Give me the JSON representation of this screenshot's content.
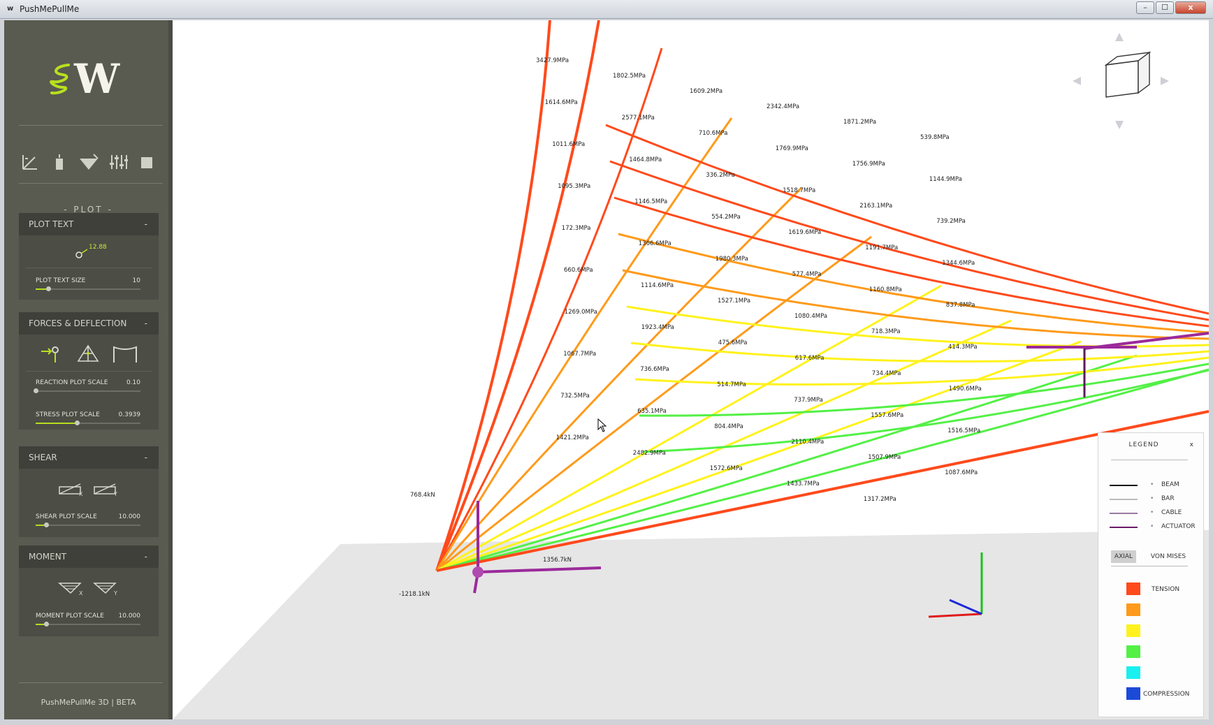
{
  "window": {
    "app_icon": "w",
    "title": "PushMePullMe",
    "minimize": "–",
    "maximize": "☐",
    "close": "x"
  },
  "sidebar": {
    "logo_text": "W",
    "tools": [
      "frame-icon",
      "load-icon",
      "support-icon",
      "sliders-icon",
      "export-icon"
    ],
    "section_label": "- PLOT -",
    "panels": {
      "plot_text": {
        "title": "PLOT TEXT",
        "collapse": "-",
        "knob_value": "12.88",
        "slider_label": "PLOT TEXT SIZE",
        "slider_value": "10",
        "slider_fraction": 0.12
      },
      "forces": {
        "title": "FORCES & DEFLECTION",
        "collapse": "-",
        "icons": [
          "reaction-icon",
          "truss-icon",
          "deflection-icon"
        ],
        "reaction_label": "REACTION PLOT SCALE",
        "reaction_value": "0.10",
        "reaction_fraction": 0.0,
        "stress_label": "STRESS PLOT SCALE",
        "stress_value": "0.3939",
        "stress_fraction": 0.39
      },
      "shear": {
        "title": "SHEAR",
        "collapse": "-",
        "icons": [
          "shear-x-icon",
          "shear-y-icon"
        ],
        "icon_subs": [
          "X",
          "Y"
        ],
        "slider_label": "SHEAR PLOT SCALE",
        "slider_value": "10.000",
        "slider_fraction": 0.1
      },
      "moment": {
        "title": "MOMENT",
        "collapse": "-",
        "icons": [
          "moment-x-icon",
          "moment-y-icon"
        ],
        "icon_subs": [
          "X",
          "Y"
        ],
        "slider_label": "MOMENT PLOT SCALE",
        "slider_value": "10.000",
        "slider_fraction": 0.1
      }
    },
    "footer": "PushMePullMe 3D | BETA"
  },
  "viewport": {
    "stress_labels": [
      "3427.9MPa",
      "1802.5MPa",
      "1609.2MPa",
      "2342.4MPa",
      "1871.2MPa",
      "539.8MPa",
      "1614.6MPa",
      "2577.1MPa",
      "710.6MPa",
      "1769.9MPa",
      "1756.9MPa",
      "1144.9MPa",
      "1011.6MPa",
      "1464.8MPa",
      "336.2MPa",
      "1518.7MPa",
      "2163.1MPa",
      "739.2MPa",
      "1095.3MPa",
      "1146.5MPa",
      "554.2MPa",
      "1619.6MPa",
      "1191.7MPa",
      "1344.6MPa",
      "172.3MPa",
      "1366.6MPa",
      "1980.3MPa",
      "577.4MPa",
      "1160.8MPa",
      "837.8MPa",
      "660.6MPa",
      "1114.6MPa",
      "1527.1MPa",
      "1080.4MPa",
      "718.3MPa",
      "414.3MPa",
      "1269.0MPa",
      "1923.4MPa",
      "475.6MPa",
      "617.6MPa",
      "734.4MPa",
      "1490.6MPa",
      "1067.7MPa",
      "736.6MPa",
      "514.7MPa",
      "737.9MPa",
      "1557.6MPa",
      "1516.5MPa",
      "732.5MPa",
      "635.1MPa",
      "804.4MPa",
      "2110.4MPa",
      "1507.9MPa",
      "1087.6MPa",
      "1421.2MPa",
      "2482.9MPa",
      "1572.6MPa",
      "1433.7MPa",
      "1317.2MPa",
      "768.4kN",
      "1356.7kN",
      "-1218.1kN"
    ],
    "legend": {
      "title": "LEGEND",
      "close": "x",
      "elements": [
        {
          "label": "BEAM",
          "color": "#111111"
        },
        {
          "label": "BAR",
          "color": "#bbbbbb"
        },
        {
          "label": "CABLE",
          "color": "#9a7aa0"
        },
        {
          "label": "ACTUATOR",
          "color": "#6a1a6a"
        }
      ],
      "bullet": "•",
      "tabs": [
        "AXIAL",
        "VON MISES"
      ],
      "active_tab": "AXIAL",
      "scale": [
        {
          "label": "TENSION",
          "color": "#ff4a1c"
        },
        {
          "label": "",
          "color": "#ff9a1a"
        },
        {
          "label": "",
          "color": "#fff21c"
        },
        {
          "label": "",
          "color": "#53f046"
        },
        {
          "label": "",
          "color": "#1af0f0"
        },
        {
          "label": "COMPRESSION",
          "color": "#1c4ad8"
        }
      ]
    }
  }
}
